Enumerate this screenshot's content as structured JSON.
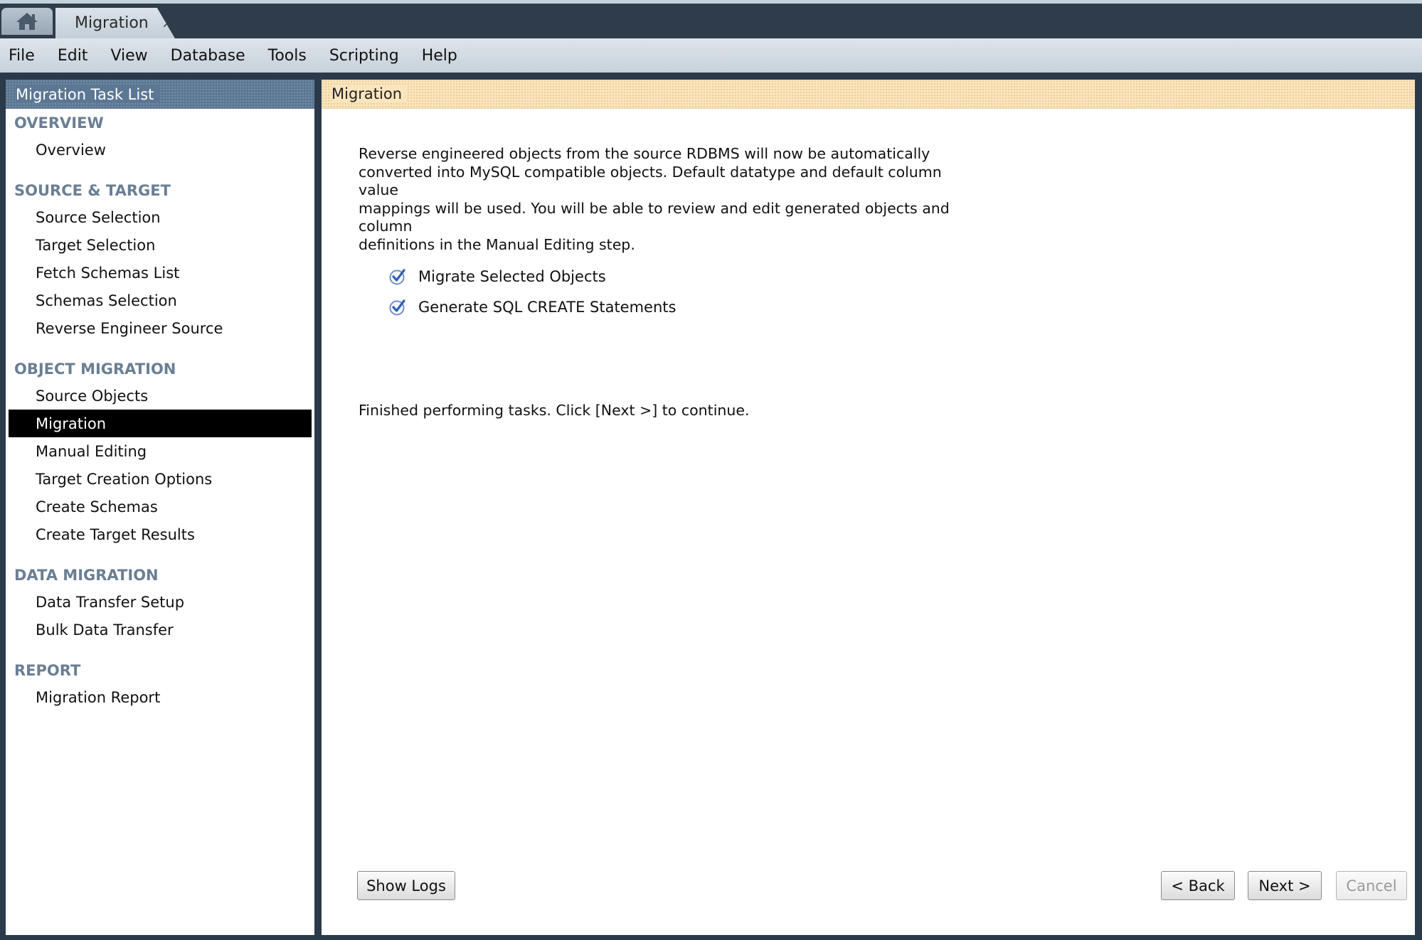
{
  "tabs": {
    "home_icon": "home-icon",
    "document_tab": {
      "label": "Migration",
      "close_glyph": "×"
    }
  },
  "menubar": {
    "items": [
      "File",
      "Edit",
      "View",
      "Database",
      "Tools",
      "Scripting",
      "Help"
    ]
  },
  "sidebar": {
    "title": "Migration Task List",
    "sections": [
      {
        "title": "OVERVIEW",
        "items": [
          "Overview"
        ]
      },
      {
        "title": "SOURCE & TARGET",
        "items": [
          "Source Selection",
          "Target Selection",
          "Fetch Schemas List",
          "Schemas Selection",
          "Reverse Engineer Source"
        ]
      },
      {
        "title": "OBJECT MIGRATION",
        "items": [
          "Source Objects",
          "Migration",
          "Manual Editing",
          "Target Creation Options",
          "Create Schemas",
          "Create Target Results"
        ]
      },
      {
        "title": "DATA MIGRATION",
        "items": [
          "Data Transfer Setup",
          "Bulk Data Transfer"
        ]
      },
      {
        "title": "REPORT",
        "items": [
          "Migration Report"
        ]
      }
    ],
    "active_item": "Migration"
  },
  "main": {
    "title": "Migration",
    "description_lines": [
      "Reverse engineered objects from the source RDBMS will now be automatically",
      "converted into MySQL compatible objects. Default datatype and default column value",
      "mappings will be used. You will be able to review and edit generated objects and column",
      "definitions in the Manual Editing step."
    ],
    "tasks": [
      {
        "label": "Migrate Selected Objects",
        "icon": "checkmark-circle-icon"
      },
      {
        "label": "Generate SQL CREATE Statements",
        "icon": "checkmark-circle-icon"
      }
    ],
    "status": "Finished performing tasks. Click [Next >] to continue.",
    "buttons": {
      "show_logs": "Show Logs",
      "back": "< Back",
      "next": "Next >",
      "cancel": "Cancel"
    }
  },
  "colors": {
    "sidebar_header": "#5c7793",
    "main_header": "#fbe5bd",
    "active_item_bg": "#000000",
    "section_title": "#6a7f94",
    "check_blue": "#2f5fb3"
  }
}
